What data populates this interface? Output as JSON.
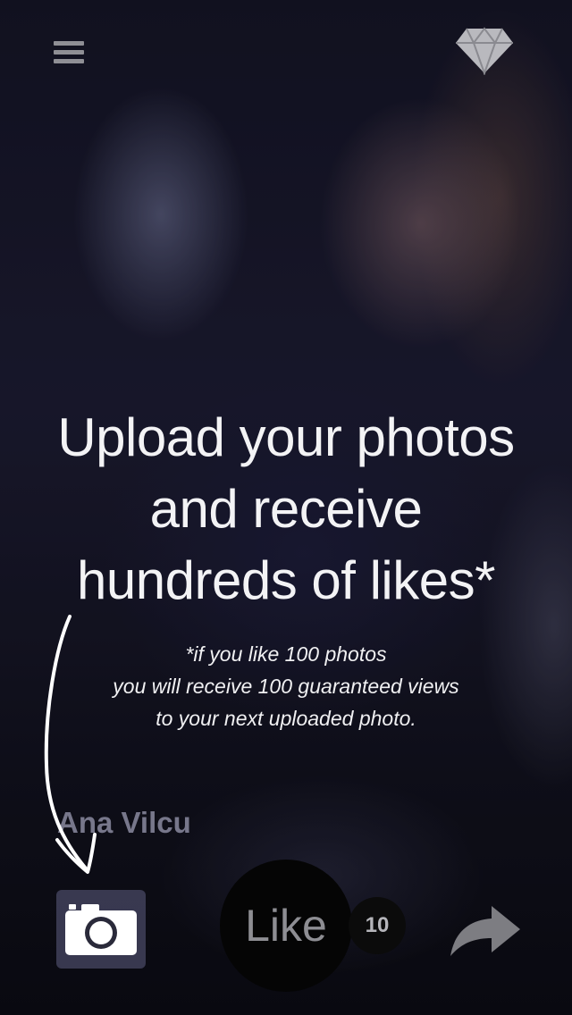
{
  "headline": "Upload your photos\nand receive\nhundreds of likes*",
  "subtext": "*if you like 100 photos\nyou will receive 100 guaranteed views\nto your next uploaded photo.",
  "user": {
    "name": "Ana Vilcu"
  },
  "like": {
    "label": "Like",
    "count": "10"
  },
  "icons": {
    "menu": "menu-icon",
    "premium": "diamond-icon",
    "camera": "camera-icon",
    "share": "share-arrow-icon",
    "hint_arrow": "arrow-icon"
  },
  "colors": {
    "overlay_text": "#f3f3f5",
    "like_button": "#050505",
    "camera_button": "#5f5f82"
  }
}
